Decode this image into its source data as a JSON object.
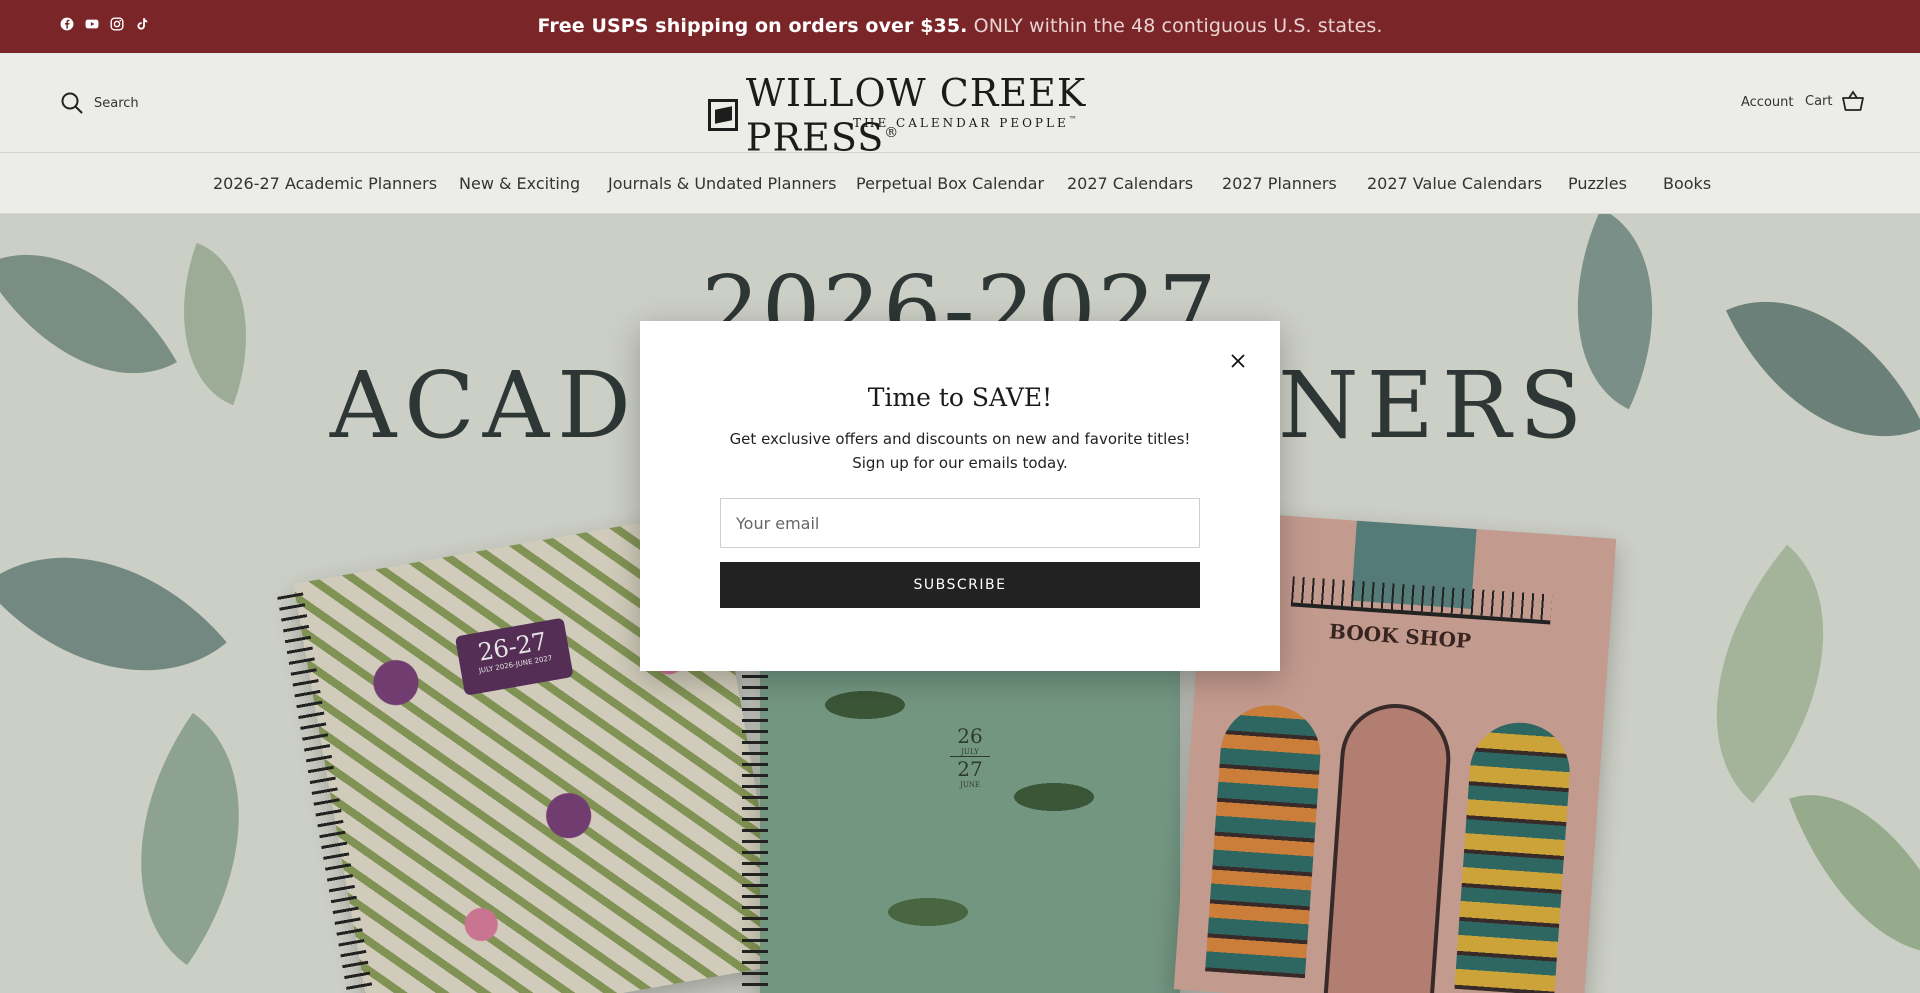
{
  "announcement": {
    "bold": "Free USPS shipping on orders over $35.",
    "rest": "ONLY within the 48 contiguous U.S. states.",
    "social": [
      "facebook-icon",
      "youtube-icon",
      "instagram-icon",
      "tiktok-icon"
    ],
    "background": "#7a2629"
  },
  "header": {
    "search_label": "Search",
    "logo_title": "WILLOW CREEK PRESS",
    "logo_registered": "®",
    "logo_subtitle": "THE CALENDAR PEOPLE",
    "logo_subtitle_tm": "™",
    "account_label": "Account",
    "cart_label": "Cart"
  },
  "nav": {
    "items": [
      {
        "label": "2026-27 Academic Planners"
      },
      {
        "label": "New & Exciting"
      },
      {
        "label": "Journals & Undated Planners"
      },
      {
        "label": "Perpetual Box Calendar"
      },
      {
        "label": "2027 Calendars"
      },
      {
        "label": "2027 Planners"
      },
      {
        "label": "2027 Value Calendars"
      },
      {
        "label": "Puzzles"
      },
      {
        "label": "Books"
      }
    ]
  },
  "hero": {
    "year": "2026-2027",
    "heading": "ACADEMIC PLANNERS",
    "planner1_badge": "26-27",
    "planner1_dates": "JULY 2026-JUNE 2027",
    "planner2_top": "26",
    "planner2_month1": "JULY",
    "planner2_bottom": "27",
    "planner2_month2": "JUNE",
    "planner3_sign": "BOOK SHOP"
  },
  "modal": {
    "title": "Time to SAVE!",
    "line1": "Get exclusive offers and discounts on new and favorite titles!",
    "line2": "Sign up for our emails today.",
    "email_placeholder": "Your email",
    "subscribe_label": "SUBSCRIBE",
    "button_color": "#222222"
  }
}
